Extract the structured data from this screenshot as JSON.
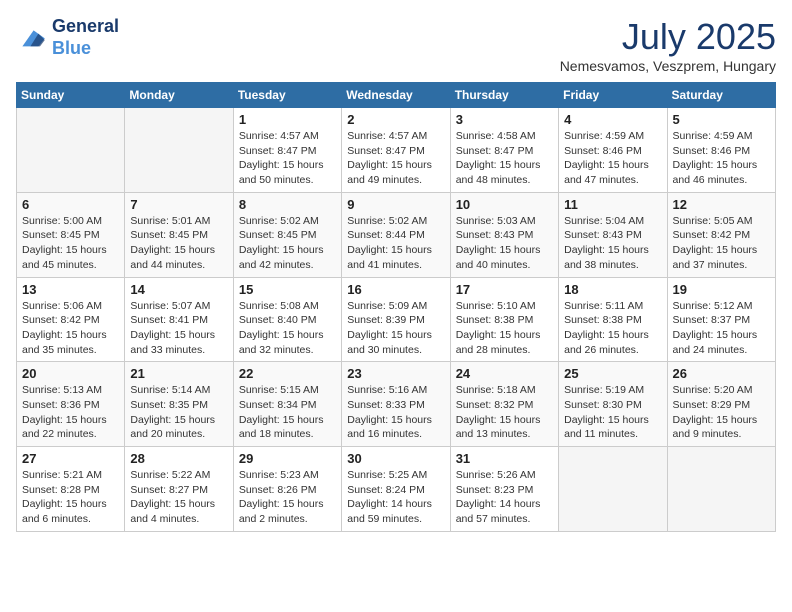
{
  "header": {
    "logo_line1": "General",
    "logo_line2": "Blue",
    "month": "July 2025",
    "location": "Nemesvamos, Veszprem, Hungary"
  },
  "weekdays": [
    "Sunday",
    "Monday",
    "Tuesday",
    "Wednesday",
    "Thursday",
    "Friday",
    "Saturday"
  ],
  "weeks": [
    [
      {
        "day": "",
        "info": ""
      },
      {
        "day": "",
        "info": ""
      },
      {
        "day": "1",
        "info": "Sunrise: 4:57 AM\nSunset: 8:47 PM\nDaylight: 15 hours\nand 50 minutes."
      },
      {
        "day": "2",
        "info": "Sunrise: 4:57 AM\nSunset: 8:47 PM\nDaylight: 15 hours\nand 49 minutes."
      },
      {
        "day": "3",
        "info": "Sunrise: 4:58 AM\nSunset: 8:47 PM\nDaylight: 15 hours\nand 48 minutes."
      },
      {
        "day": "4",
        "info": "Sunrise: 4:59 AM\nSunset: 8:46 PM\nDaylight: 15 hours\nand 47 minutes."
      },
      {
        "day": "5",
        "info": "Sunrise: 4:59 AM\nSunset: 8:46 PM\nDaylight: 15 hours\nand 46 minutes."
      }
    ],
    [
      {
        "day": "6",
        "info": "Sunrise: 5:00 AM\nSunset: 8:45 PM\nDaylight: 15 hours\nand 45 minutes."
      },
      {
        "day": "7",
        "info": "Sunrise: 5:01 AM\nSunset: 8:45 PM\nDaylight: 15 hours\nand 44 minutes."
      },
      {
        "day": "8",
        "info": "Sunrise: 5:02 AM\nSunset: 8:45 PM\nDaylight: 15 hours\nand 42 minutes."
      },
      {
        "day": "9",
        "info": "Sunrise: 5:02 AM\nSunset: 8:44 PM\nDaylight: 15 hours\nand 41 minutes."
      },
      {
        "day": "10",
        "info": "Sunrise: 5:03 AM\nSunset: 8:43 PM\nDaylight: 15 hours\nand 40 minutes."
      },
      {
        "day": "11",
        "info": "Sunrise: 5:04 AM\nSunset: 8:43 PM\nDaylight: 15 hours\nand 38 minutes."
      },
      {
        "day": "12",
        "info": "Sunrise: 5:05 AM\nSunset: 8:42 PM\nDaylight: 15 hours\nand 37 minutes."
      }
    ],
    [
      {
        "day": "13",
        "info": "Sunrise: 5:06 AM\nSunset: 8:42 PM\nDaylight: 15 hours\nand 35 minutes."
      },
      {
        "day": "14",
        "info": "Sunrise: 5:07 AM\nSunset: 8:41 PM\nDaylight: 15 hours\nand 33 minutes."
      },
      {
        "day": "15",
        "info": "Sunrise: 5:08 AM\nSunset: 8:40 PM\nDaylight: 15 hours\nand 32 minutes."
      },
      {
        "day": "16",
        "info": "Sunrise: 5:09 AM\nSunset: 8:39 PM\nDaylight: 15 hours\nand 30 minutes."
      },
      {
        "day": "17",
        "info": "Sunrise: 5:10 AM\nSunset: 8:38 PM\nDaylight: 15 hours\nand 28 minutes."
      },
      {
        "day": "18",
        "info": "Sunrise: 5:11 AM\nSunset: 8:38 PM\nDaylight: 15 hours\nand 26 minutes."
      },
      {
        "day": "19",
        "info": "Sunrise: 5:12 AM\nSunset: 8:37 PM\nDaylight: 15 hours\nand 24 minutes."
      }
    ],
    [
      {
        "day": "20",
        "info": "Sunrise: 5:13 AM\nSunset: 8:36 PM\nDaylight: 15 hours\nand 22 minutes."
      },
      {
        "day": "21",
        "info": "Sunrise: 5:14 AM\nSunset: 8:35 PM\nDaylight: 15 hours\nand 20 minutes."
      },
      {
        "day": "22",
        "info": "Sunrise: 5:15 AM\nSunset: 8:34 PM\nDaylight: 15 hours\nand 18 minutes."
      },
      {
        "day": "23",
        "info": "Sunrise: 5:16 AM\nSunset: 8:33 PM\nDaylight: 15 hours\nand 16 minutes."
      },
      {
        "day": "24",
        "info": "Sunrise: 5:18 AM\nSunset: 8:32 PM\nDaylight: 15 hours\nand 13 minutes."
      },
      {
        "day": "25",
        "info": "Sunrise: 5:19 AM\nSunset: 8:30 PM\nDaylight: 15 hours\nand 11 minutes."
      },
      {
        "day": "26",
        "info": "Sunrise: 5:20 AM\nSunset: 8:29 PM\nDaylight: 15 hours\nand 9 minutes."
      }
    ],
    [
      {
        "day": "27",
        "info": "Sunrise: 5:21 AM\nSunset: 8:28 PM\nDaylight: 15 hours\nand 6 minutes."
      },
      {
        "day": "28",
        "info": "Sunrise: 5:22 AM\nSunset: 8:27 PM\nDaylight: 15 hours\nand 4 minutes."
      },
      {
        "day": "29",
        "info": "Sunrise: 5:23 AM\nSunset: 8:26 PM\nDaylight: 15 hours\nand 2 minutes."
      },
      {
        "day": "30",
        "info": "Sunrise: 5:25 AM\nSunset: 8:24 PM\nDaylight: 14 hours\nand 59 minutes."
      },
      {
        "day": "31",
        "info": "Sunrise: 5:26 AM\nSunset: 8:23 PM\nDaylight: 14 hours\nand 57 minutes."
      },
      {
        "day": "",
        "info": ""
      },
      {
        "day": "",
        "info": ""
      }
    ]
  ]
}
